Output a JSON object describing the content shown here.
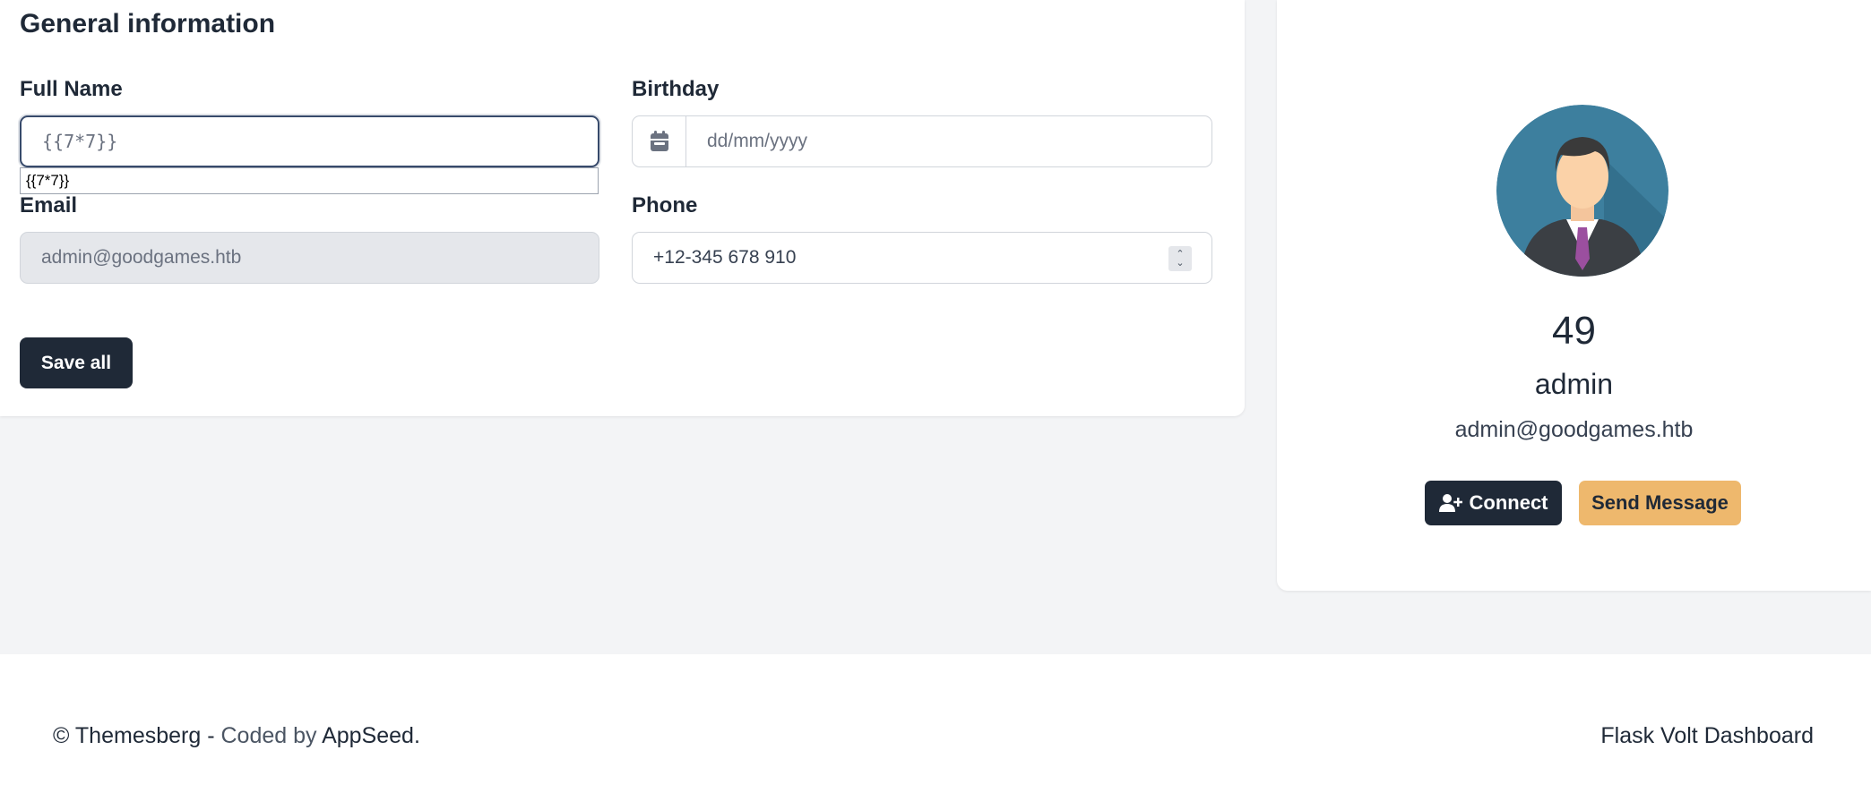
{
  "form": {
    "title": "General information",
    "full_name": {
      "label": "Full Name",
      "value": "{{7*7}}",
      "autocomplete": "{{7*7}}"
    },
    "birthday": {
      "label": "Birthday",
      "placeholder": "dd/mm/yyyy",
      "icon": "calendar-icon"
    },
    "email": {
      "label": "Email",
      "value": "admin@goodgames.htb"
    },
    "phone": {
      "label": "Phone",
      "value": "+12-345 678 910"
    },
    "save_label": "Save all"
  },
  "profile": {
    "number": "49",
    "name": "admin",
    "email": "admin@goodgames.htb",
    "connect_label": "Connect",
    "message_label": "Send Message"
  },
  "footer": {
    "copyright": "© Themesberg - ",
    "coded_by": "Coded by ",
    "appseed": "AppSeed.",
    "brand": "Flask Volt Dashboard"
  },
  "colors": {
    "primary": "#1f2937",
    "secondary": "#eeb86d",
    "background": "#f3f4f6"
  }
}
